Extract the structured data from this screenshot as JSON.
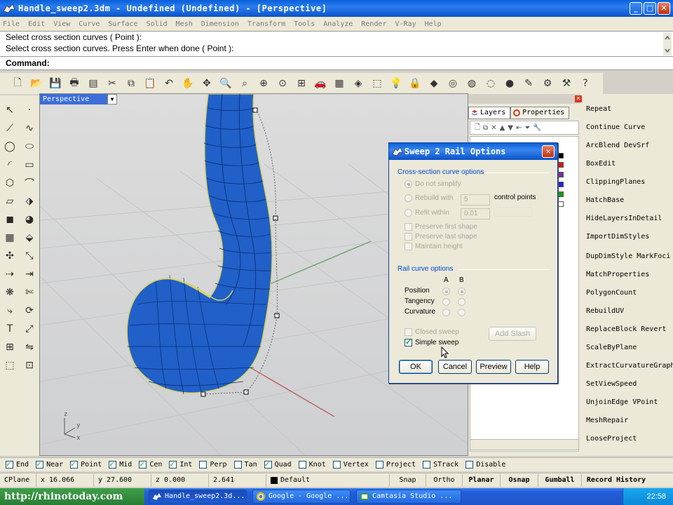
{
  "window": {
    "title": "Handle_sweep2.3dm - Undefined (Undefined) - [Perspective]",
    "controls": {
      "minimize": "_",
      "maximize": "□",
      "close": "✕"
    }
  },
  "menu": [
    "File",
    "Edit",
    "View",
    "Curve",
    "Surface",
    "Solid",
    "Mesh",
    "Dimension",
    "Transform",
    "Tools",
    "Analyze",
    "Render",
    "V-Ray",
    "Help"
  ],
  "command_history": [
    "Select cross section curves ( Point ):",
    "Select cross section curves. Press Enter when done ( Point ):"
  ],
  "command_prompt": "Command:",
  "viewport": {
    "tab_label": "Perspective",
    "axis_labels": {
      "z": "z",
      "y": "y",
      "x": "x"
    }
  },
  "panel": {
    "tabs": [
      "Layers",
      "Properties"
    ],
    "layer_colors": [
      "#000000",
      "#e01010",
      "#7030a0",
      "#2020e0",
      "#10a010",
      "#ffffff"
    ]
  },
  "macros": [
    "Repeat",
    "Continue Curve",
    "ArcBlend  DevSrf",
    "BoxEdit",
    "ClippingPlanes",
    "HatchBase",
    "HideLayersInDetail",
    "ImportDimStyles",
    "DupDimStyle  MarkFoci",
    "MatchProperties",
    "PolygonCount",
    "RebuildUV",
    "ReplaceBlock  Revert",
    "ScaleByPlane",
    "ExtractCurvatureGraph",
    "SetViewSpeed",
    "UnjoinEdge  VPoint",
    "MeshRepair",
    "LooseProject"
  ],
  "dialog": {
    "title": "Sweep 2 Rail Options",
    "cross_section_header": "Cross-section curve options",
    "do_not_simplify": "Do not simplify",
    "rebuild_with": "Rebuild with",
    "rebuild_value": "5",
    "control_points": "control points",
    "refit_within": "Refit within",
    "refit_value": "0.01",
    "preserve_first": "Preserve first shape",
    "preserve_last": "Preserve last shape",
    "maintain_height": "Maintain height",
    "rail_header": "Rail curve options",
    "col_a": "A",
    "col_b": "B",
    "position": "Position",
    "tangency": "Tangency",
    "curvature": "Curvature",
    "closed_sweep": "Closed sweep",
    "add_slash": "Add Slash",
    "simple_sweep": "Simple sweep",
    "ok": "OK",
    "cancel": "Cancel",
    "preview": "Preview",
    "help": "Help"
  },
  "osnaps": [
    {
      "label": "End",
      "checked": true
    },
    {
      "label": "Near",
      "checked": true
    },
    {
      "label": "Point",
      "checked": true
    },
    {
      "label": "Mid",
      "checked": true
    },
    {
      "label": "Cen",
      "checked": true
    },
    {
      "label": "Int",
      "checked": true
    },
    {
      "label": "Perp",
      "checked": false
    },
    {
      "label": "Tan",
      "checked": false
    },
    {
      "label": "Quad",
      "checked": true
    },
    {
      "label": "Knot",
      "checked": false
    },
    {
      "label": "Vertex",
      "checked": false
    },
    {
      "label": "Project",
      "checked": false
    },
    {
      "label": "STrack",
      "checked": false
    },
    {
      "label": "Disable",
      "checked": false
    }
  ],
  "status": {
    "cplane": "CPlane",
    "x": "x 16.066",
    "y": "y 27.600",
    "z": "z 0.000",
    "distance": "2.641",
    "layer": "Default",
    "snap": "Snap",
    "ortho": "Ortho",
    "planar": "Planar",
    "osnap": "Osnap",
    "gumball": "Gumball",
    "record_history": "Record History"
  },
  "taskbar": {
    "url": "http://rhinotoday.com",
    "tasks": [
      "Handle_sweep2.3d...",
      "Google - Google ...",
      "Camtasia Studio ..."
    ],
    "clock": "22:58"
  }
}
